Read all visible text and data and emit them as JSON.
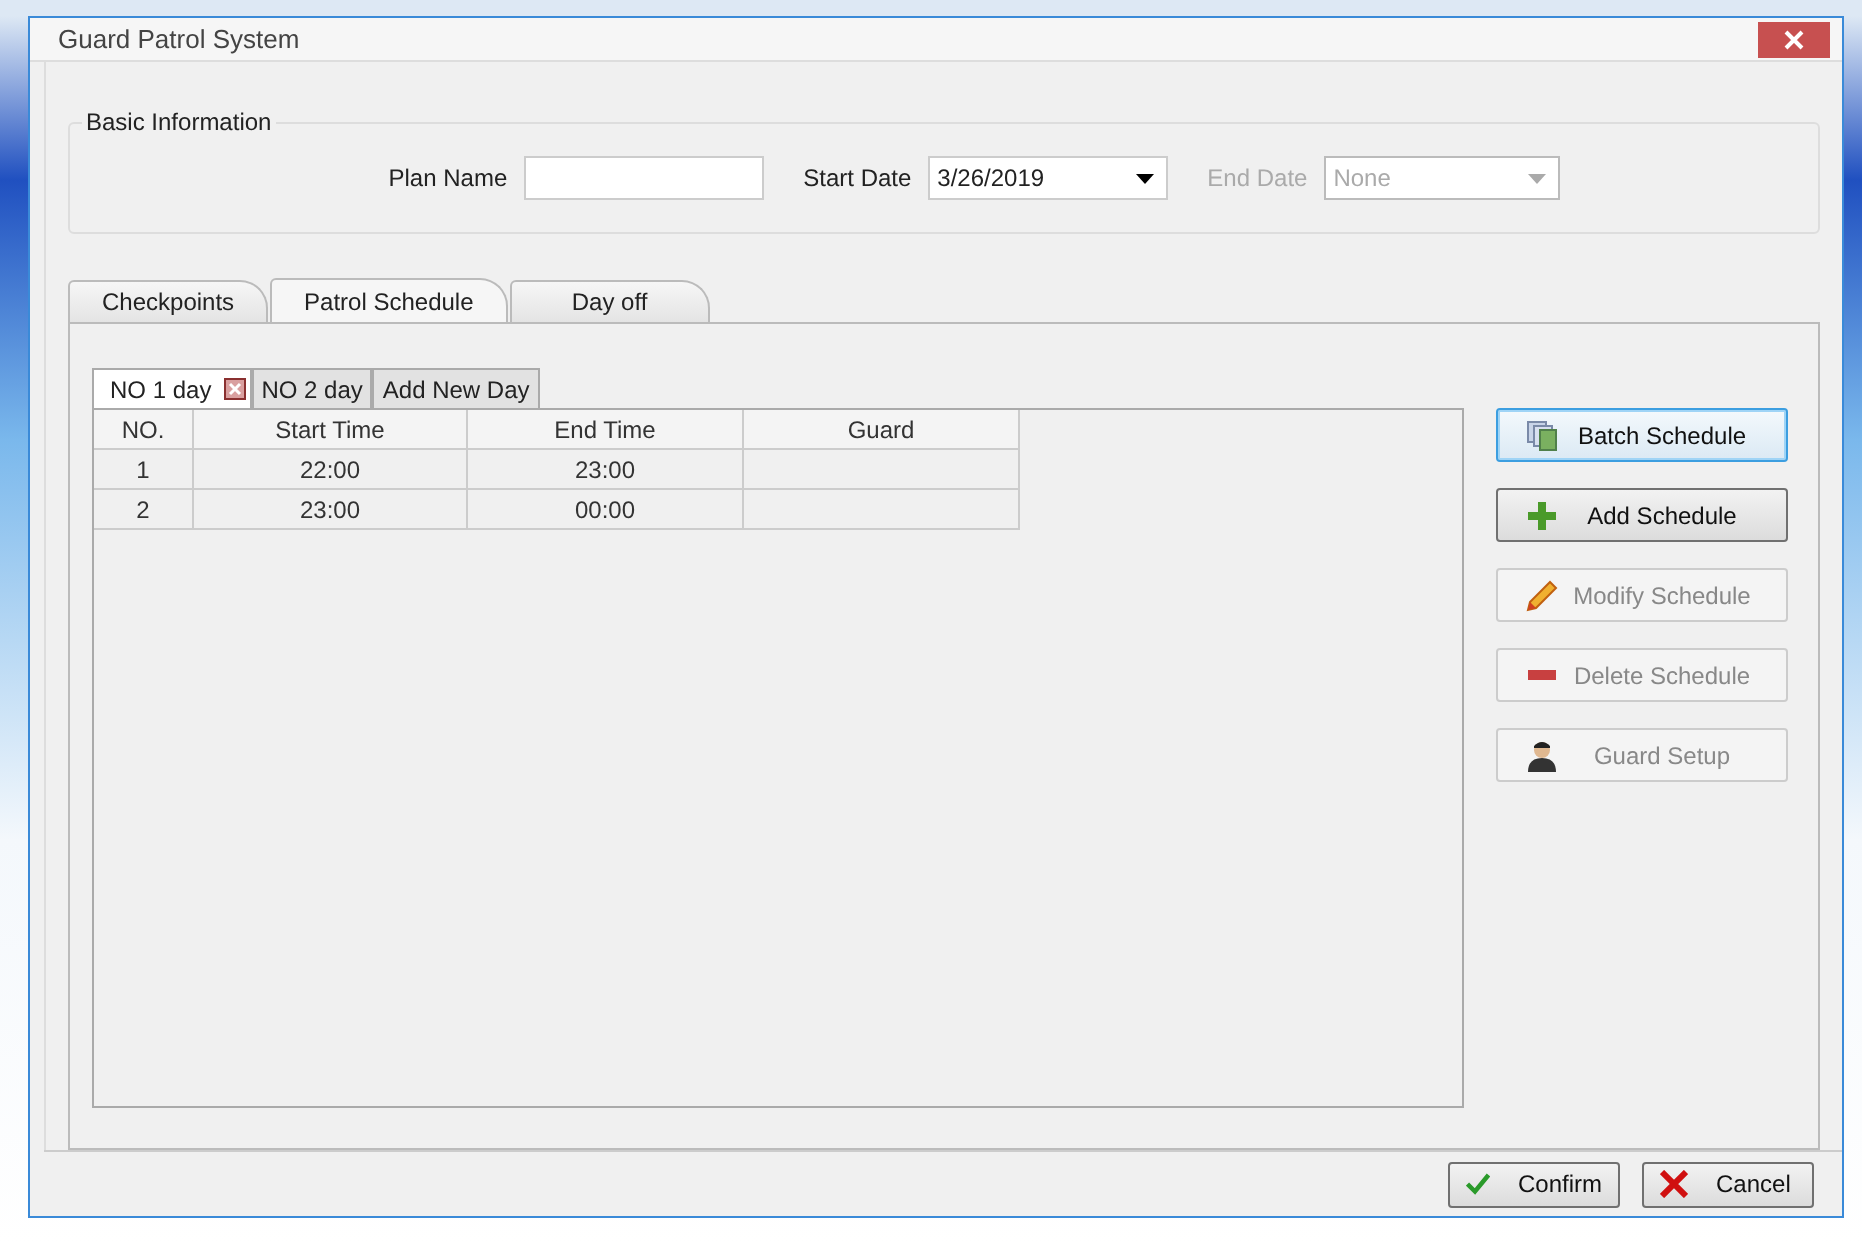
{
  "window": {
    "title": "Guard Patrol System"
  },
  "basic_information": {
    "title": "Basic Information",
    "plan_name": {
      "label": "Plan Name"
    },
    "start_date": {
      "label": "Start Date",
      "value": "3/26/2019",
      "disabled": false
    },
    "end_date": {
      "label": "End Date",
      "value": "None",
      "disabled": true
    }
  },
  "tabs": [
    {
      "label": "Checkpoints",
      "selected": false
    },
    {
      "label": "Patrol Schedule",
      "selected": true
    },
    {
      "label": "Day off",
      "selected": false
    }
  ],
  "day_tabs": [
    {
      "label": "NO 1 day",
      "selected": true
    },
    {
      "label": "NO 2 day",
      "selected": false
    },
    {
      "label": "Add New Day",
      "selected": false
    }
  ],
  "table": {
    "columns": [
      "NO.",
      "Start Time",
      "End Time",
      "Guard"
    ],
    "rows": [
      [
        "1",
        "22:00",
        "23:00",
        null
      ],
      [
        "2",
        "23:00",
        "00:00",
        null
      ]
    ]
  },
  "actions": [
    {
      "label": "Batch Schedule",
      "kind": "batch",
      "disabled": false,
      "focused": true
    },
    {
      "label": "Add Schedule",
      "kind": "add",
      "disabled": false,
      "focused": false
    },
    {
      "label": "Modify Schedule",
      "kind": "modify",
      "disabled": true,
      "focused": false
    },
    {
      "label": "Delete Schedule",
      "kind": "delete",
      "disabled": true,
      "focused": false
    },
    {
      "label": "Guard Setup",
      "kind": "guard",
      "disabled": true,
      "focused": false
    }
  ],
  "footer_buttons": [
    {
      "label": "Confirm",
      "kind": "confirm"
    },
    {
      "label": "Cancel",
      "kind": "cancel"
    }
  ]
}
